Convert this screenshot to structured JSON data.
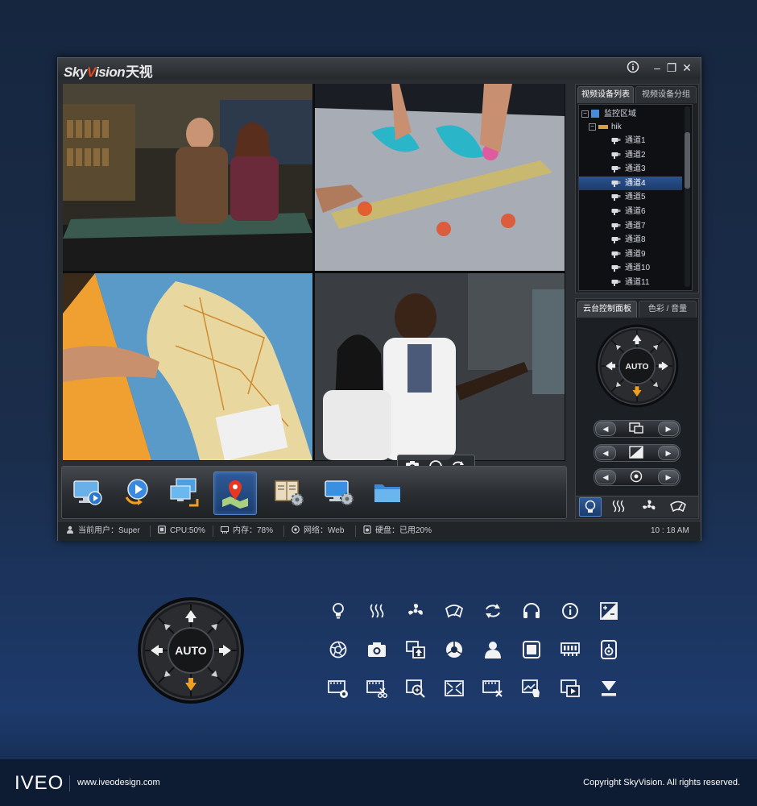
{
  "app": {
    "logo_sky": "Sky",
    "logo_v": "V",
    "logo_ision": "ision",
    "logo_cn": "天视"
  },
  "window_controls": {
    "info": "i",
    "minimize": "–",
    "restore": "❐",
    "close": "✕"
  },
  "device_panel": {
    "tabs": [
      "视频设备列表",
      "视频设备分组"
    ],
    "root": "监控区域",
    "device": "hik",
    "channels": [
      "通道1",
      "通道2",
      "通道3",
      "通道4",
      "通道5",
      "通道6",
      "通道7",
      "通道8",
      "通道9",
      "通道10",
      "通道11"
    ],
    "selected": "通道4"
  },
  "ptz_panel": {
    "tabs": [
      "云台控制面板",
      "色彩 / 音量"
    ],
    "auto_label": "AUTO"
  },
  "status": {
    "user_label": "当前用户：Super",
    "cpu_label": "CPU:50%",
    "mem_label": "内存：78%",
    "net_label": "网络：Web",
    "disk_label": "硬盘：已用20%",
    "time": "10 : 18 AM"
  },
  "showcase": {
    "auto_label": "AUTO"
  },
  "footer": {
    "brand": "IVEO",
    "url": "www.iveodesign.com",
    "copyright": "Copyright SkyVision. All rights reserved."
  },
  "colors": {
    "accent": "#e84820",
    "selection": "#2a5490",
    "arrow_active": "#f0a020"
  },
  "icons": {
    "dock": [
      "monitor-play-icon",
      "play-circle-icon",
      "multi-monitor-icon",
      "map-pin-icon",
      "book-settings-icon",
      "monitor-settings-icon",
      "folder-icon"
    ],
    "camera_toolbar": [
      "camera-icon",
      "headphones-icon",
      "refresh-icon"
    ],
    "ptz_bottom": [
      "bulb-icon",
      "heat-icon",
      "fan-icon",
      "wiper-icon"
    ]
  }
}
